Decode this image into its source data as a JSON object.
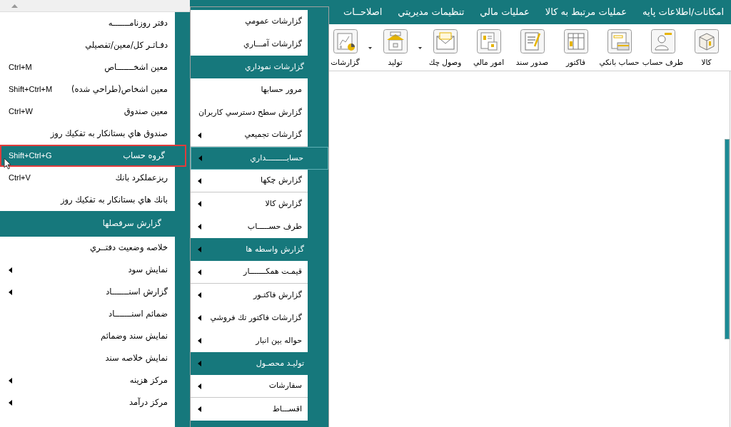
{
  "menu_bar": [
    {
      "label": "امكانات/اطلاعات پايه"
    },
    {
      "label": "عمليات مرتبط به كالا"
    },
    {
      "label": "عمليات مالي"
    },
    {
      "label": "تنظيمات مديريتي"
    },
    {
      "label": "اصلاحــات"
    }
  ],
  "toolbar": [
    {
      "label": "كالا",
      "dropdown": false
    },
    {
      "label": "طرف حساب",
      "dropdown": false
    },
    {
      "label": "حساب بانكي",
      "dropdown": false
    },
    {
      "label": "فاكتور",
      "dropdown": false
    },
    {
      "label": "صدور سند",
      "dropdown": false
    },
    {
      "label": "امور مالي",
      "dropdown": false
    },
    {
      "label": "وصول چك",
      "dropdown": true
    },
    {
      "label": "توليد",
      "dropdown": true
    },
    {
      "label": "گزارشات",
      "dropdown": false
    }
  ],
  "reports_menu": [
    {
      "kind": "item",
      "label": "گزارشات عمومي",
      "submenu": false,
      "selected": false,
      "divider_after": false
    },
    {
      "kind": "item",
      "label": "گزارشات آمـــاري",
      "submenu": false,
      "selected": false,
      "divider_after": false
    },
    {
      "kind": "header",
      "label": "گزارشات نموداري",
      "submenu": false,
      "selected": false,
      "divider_after": false
    },
    {
      "kind": "item",
      "label": "مرور حسابها",
      "submenu": false,
      "selected": false,
      "divider_after": false
    },
    {
      "kind": "item",
      "label": "گزارش سطح دسترسي كاربران",
      "submenu": false,
      "selected": false,
      "divider_after": false
    },
    {
      "kind": "item",
      "label": "گزارشات تجميعي",
      "submenu": true,
      "selected": false,
      "divider_after": true
    },
    {
      "kind": "header",
      "label": "حسابـــــــــداري",
      "submenu": true,
      "selected": true,
      "divider_after": false
    },
    {
      "kind": "item",
      "label": "گزارش چكها",
      "submenu": true,
      "selected": false,
      "divider_after": true
    },
    {
      "kind": "item",
      "label": "گزارش كالا",
      "submenu": true,
      "selected": false,
      "divider_after": false
    },
    {
      "kind": "item",
      "label": "طرف حســـــاب",
      "submenu": true,
      "selected": false,
      "divider_after": false
    },
    {
      "kind": "header",
      "label": "گزارش واسطه ها",
      "submenu": true,
      "selected": false,
      "divider_after": false
    },
    {
      "kind": "item",
      "label": "قيمـت همكـــــــار",
      "submenu": true,
      "selected": false,
      "divider_after": true
    },
    {
      "kind": "item",
      "label": "گزارش فاكتـور",
      "submenu": true,
      "selected": false,
      "divider_after": false
    },
    {
      "kind": "item",
      "label": "گزارشات فاكتور تك فروشي",
      "submenu": true,
      "selected": false,
      "divider_after": false
    },
    {
      "kind": "item",
      "label": "حواله بين انبار",
      "submenu": true,
      "selected": false,
      "divider_after": false
    },
    {
      "kind": "header",
      "label": "توليـد محصـول",
      "submenu": true,
      "selected": false,
      "divider_after": false
    },
    {
      "kind": "item",
      "label": "سفارشات",
      "submenu": true,
      "selected": false,
      "divider_after": true
    },
    {
      "kind": "item",
      "label": "اقســـاط",
      "submenu": true,
      "selected": false,
      "divider_after": false
    }
  ],
  "accounting_menu": [
    {
      "kind": "item",
      "label": "دفتر روزنامـــــــه",
      "submenu": false,
      "selected": false
    },
    {
      "kind": "item",
      "label": "دفـاتـر كل/معين/تفصيلي",
      "submenu": false,
      "selected": false
    },
    {
      "kind": "item",
      "label": "معين اشخـــــــاص",
      "shortcut": "Ctrl+M",
      "submenu": false,
      "selected": false
    },
    {
      "kind": "item",
      "label": "معين اشخاص(طراحي شده)",
      "shortcut": "Shift+Ctrl+M",
      "submenu": false,
      "selected": false
    },
    {
      "kind": "item",
      "label": "معين صندوق",
      "shortcut": "Ctrl+W",
      "submenu": false,
      "selected": false
    },
    {
      "kind": "item",
      "label": "صندوق هاي بستانكار به تفكيك روز",
      "submenu": false,
      "selected": false
    },
    {
      "kind": "item",
      "label": "گروه حساب",
      "shortcut": "Shift+Ctrl+G",
      "submenu": false,
      "selected": true
    },
    {
      "kind": "item",
      "label": "ريزعملكرد بانك",
      "shortcut": "Ctrl+V",
      "submenu": false,
      "selected": false
    },
    {
      "kind": "item",
      "label": "بانك هاي بستانكار به تفكيك روز",
      "submenu": false,
      "selected": false
    },
    {
      "kind": "header",
      "label": "گزارش سرفصلها",
      "submenu": false,
      "selected": false
    },
    {
      "kind": "item",
      "label": "خلاصه وضعيت دفتــري",
      "submenu": false,
      "selected": false
    },
    {
      "kind": "item",
      "label": "نمايش سود",
      "submenu": true,
      "selected": false
    },
    {
      "kind": "item",
      "label": "گزارش  اسنـــــــاد",
      "submenu": true,
      "selected": false
    },
    {
      "kind": "item",
      "label": "ضمائم اسنـــــــاد",
      "submenu": false,
      "selected": false
    },
    {
      "kind": "item",
      "label": "نمايش سند وضمائم",
      "submenu": false,
      "selected": false
    },
    {
      "kind": "item",
      "label": "نمايش خلاصه سند",
      "submenu": false,
      "selected": false
    },
    {
      "kind": "item",
      "label": "مركز هزينه",
      "submenu": true,
      "selected": false
    },
    {
      "kind": "item",
      "label": "مركز درآمد",
      "submenu": true,
      "selected": false
    }
  ]
}
